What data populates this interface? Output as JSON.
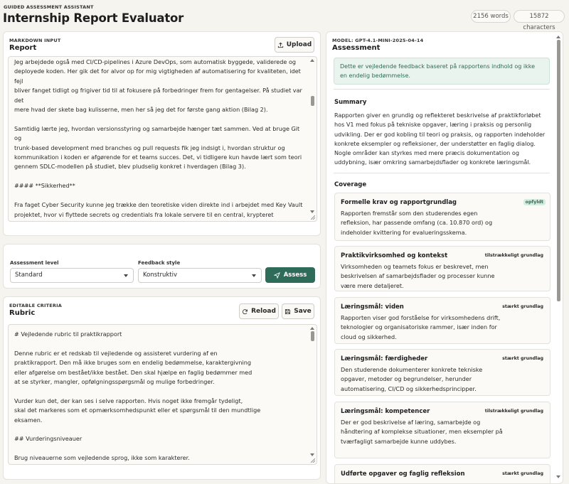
{
  "header": {
    "eyebrow": "GUIDED ASSESSMENT ASSISTANT",
    "title": "Internship Report Evaluator",
    "word_count": "2156 words",
    "char_count": "15872 characters"
  },
  "markdown_card": {
    "eyebrow": "MARKDOWN INPUT",
    "title": "Report",
    "upload_label": "Upload",
    "text": "Jeg arbejdede også med CI/CD-pipelines i Azure DevOps, som automatisk byggede, validerede og\ndeployede koden. Her gik det for alvor op for mig vigtigheden af automatisering for kvaliteten, idet fejl\nbliver fanget tidligt og frigiver tid til at fokusere på forbedringer frem for gentagelser. På studiet var det\nmere hvad der skete bag kulisserne, men her så jeg det for første gang aktion (Bilag 2).\n\nSamtidig lærte jeg, hvordan versionsstyring og samarbejde hænger tæt sammen. Ved at bruge Git og\ntrunk-based development med branches og pull requests fik jeg indsigt i, hvordan struktur og\nkommunikation i koden er afgørende for et teams succes. Det, vi tidligere kun havde lært som teori\ngennem SDLC-modellen på studiet, blev pludselig konkret i hverdagen (Bilag 3).\n\n#### **Sikkerhed**\n\nFra faget Cyber Security kunne jeg trække den teoretiske viden direkte ind i arbejdet med Key Vault\nprojektet, hvor vi flyttede secrets og credentials fra lokale servere til en central, krypteret cloudløsning.\nHer blev CIA-triaden (Confidentiality, Integrity og Availability) et aktivt redskab i beslutninger, der blev\ntruffet under designet. Jeg fik implementeret Role-Based Access Control (RBAC) og least privilege\nprincipper, så brugere og systemer kun fik adgang til det, de faktisk"
  },
  "controls": {
    "level_label": "Assessment level",
    "level_value": "Standard",
    "style_label": "Feedback style",
    "style_value": "Konstruktiv",
    "assess_label": "Assess"
  },
  "rubric_card": {
    "eyebrow": "EDITABLE CRITERIA",
    "title": "Rubric",
    "reload_label": "Reload",
    "save_label": "Save",
    "text": "# Vejledende rubric til praktikrapport\n\nDenne rubric er et redskab til vejledende og assisteret vurdering af en\npraktikrapport. Den må ikke bruges som en endelig bedømmelse, karaktergivning\neller afgørelse om bestået/ikke bestået. Den skal hjælpe en faglig bedømmer med\nat se styrker, mangler, opfølgningsspørgsmål og mulige forbedringer.\n\nVurder kun det, der kan ses i selve rapporten. Hvis noget ikke fremgår tydeligt,\nskal det markeres som et opmærksomhedspunkt eller et spørgsmål til den mundtlige\neksamen.\n\n## Vurderingsniveauer\n\nBrug niveauerne som vejledende sprog, ikke som karakterer."
  },
  "assessment": {
    "model": "MODEL: GPT-4.1-MINI-2025-04-14",
    "title": "Assessment",
    "notice": "Dette er vejledende feedback baseret på rapportens indhold og ikke en endelig bedømmelse.",
    "summary_heading": "Summary",
    "summary": "Rapporten giver en grundig og reflekteret beskrivelse af praktikforløbet hos V1 med fokus på tekniske opgaver, læring i praksis og personlig udvikling. Der er god kobling til teori og praksis, og rapporten indeholder konkrete eksempler og refleksioner, der understøtter en faglig dialog. Nogle områder kan styrkes med mere præcis dokumentation og uddybning, især omkring samarbejdsflader og konkrete læringsmål.",
    "coverage_heading": "Coverage",
    "coverage": [
      {
        "title": "Formelle krav og rapportgrundlag",
        "badge": "opfyldt",
        "text": "Rapporten fremstår som den studerendes egen refleksion, har passende omfang (ca. 10.870 ord) og indeholder kvittering for evalueringsskema."
      },
      {
        "title": "Praktikvirksomhed og kontekst",
        "badge": "tilstrækkeligt grundlag",
        "text": "Virksomheden og teamets fokus er beskrevet, men beskrivelsen af samarbejdsflader og processer kunne være mere detaljeret."
      },
      {
        "title": "Læringsmål: viden",
        "badge": "stærkt grundlag",
        "text": "Rapporten viser god forståelse for virksomhedens drift, teknologier og organisatoriske rammer, især inden for cloud og sikkerhed."
      },
      {
        "title": "Læringsmål: færdigheder",
        "badge": "stærkt grundlag",
        "text": "Den studerende dokumenterer konkrete tekniske opgaver, metoder og begrundelser, herunder automatisering, CI/CD og sikkerhedsprincipper."
      },
      {
        "title": "Læringsmål: kompetencer",
        "badge": "tilstrækkeligt grundlag",
        "text": "Der er god beskrivelse af læring, samarbejde og håndtering af komplekse situationer, men eksempler på tværfagligt samarbejde kunne uddybes."
      },
      {
        "title": "Udførte opgaver og faglig refleksion",
        "badge": "stærkt grundlag",
        "text": ""
      }
    ]
  }
}
